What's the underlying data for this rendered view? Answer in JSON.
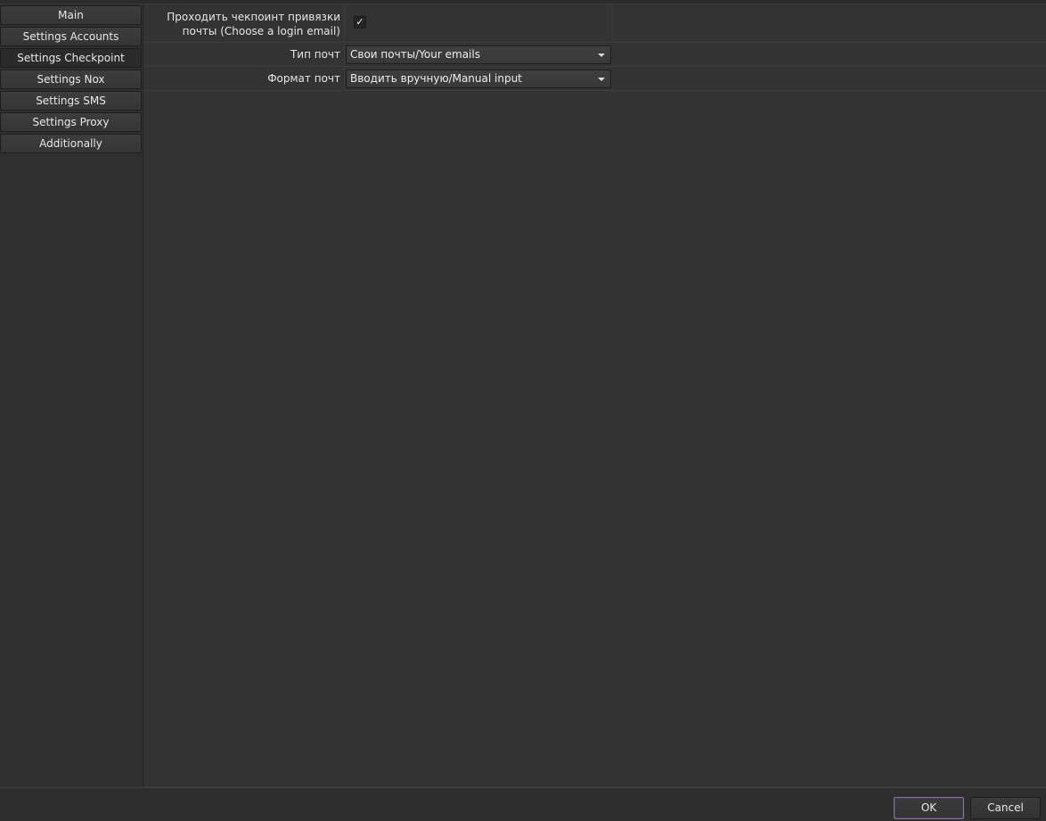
{
  "sidebar": {
    "items": [
      {
        "label": "Main"
      },
      {
        "label": "Settings Accounts"
      },
      {
        "label": "Settings Checkpoint"
      },
      {
        "label": "Settings Nox"
      },
      {
        "label": "Settings SMS"
      },
      {
        "label": "Settings Proxy"
      },
      {
        "label": "Additionally"
      }
    ],
    "active_index": 2
  },
  "form": {
    "checkpoint": {
      "label_line1": "Проходить чекпоинт привязки",
      "label_line2": "почты (Choose a login email)",
      "checked": true,
      "check_glyph": "✓"
    },
    "mail_type": {
      "label": "Тип почт",
      "value": "Свои почты/Your emails"
    },
    "mail_format": {
      "label": "Формат почт",
      "value": "Вводить вручную/Manual input"
    }
  },
  "dialog": {
    "ok_label": "OK",
    "cancel_label": "Cancel"
  },
  "icons": {
    "combo_arrow": "chevron-down-icon",
    "check": "checkmark-icon"
  },
  "colors": {
    "background": "#333333",
    "sidebar": "#2f2f2f",
    "accent_ok_border": "#8a6fa8"
  }
}
